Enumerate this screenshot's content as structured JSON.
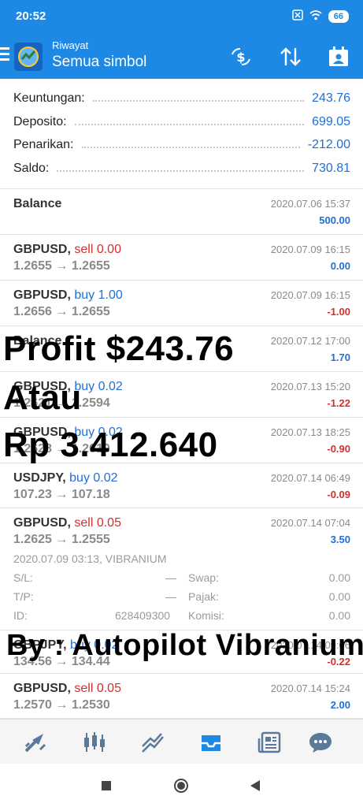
{
  "status": {
    "time": "20:52",
    "battery": "66"
  },
  "toolbar": {
    "subtitle": "Riwayat",
    "title": "Semua simbol"
  },
  "summary": {
    "profit_label": "Keuntungan:",
    "profit_value": "243.76",
    "deposit_label": "Deposito:",
    "deposit_value": "699.05",
    "withdrawal_label": "Penarikan:",
    "withdrawal_value": "-212.00",
    "balance_label": "Saldo:",
    "balance_value": "730.81"
  },
  "rows": [
    {
      "symbol": "Balance",
      "side": "",
      "volume": "",
      "prices": "",
      "time": "2020.07.06 15:37",
      "profit": "500.00"
    },
    {
      "symbol": "GBPUSD,",
      "side": "sell",
      "volume": "0.00",
      "prices": "1.2655 → 1.2655",
      "time": "2020.07.09 16:15",
      "profit": "0.00"
    },
    {
      "symbol": "GBPUSD,",
      "side": "buy",
      "volume": "1.00",
      "prices": "1.2656 → 1.2655",
      "time": "2020.07.09 16:15",
      "profit": "-1.00"
    },
    {
      "symbol": "Balance",
      "side": "",
      "volume": "",
      "prices": "",
      "time": "2020.07.12 17:00",
      "profit": "1.70"
    },
    {
      "symbol": "GBPUSD,",
      "side": "buy",
      "volume": "0.02",
      "prices": "1.2621 → 1.2594",
      "time": "2020.07.13 15:20",
      "profit": "-1.22"
    },
    {
      "symbol": "GBPUSD,",
      "side": "buy",
      "volume": "0.02",
      "prices": "1.2628 → 1.2610",
      "time": "2020.07.13 18:25",
      "profit": "-0.90"
    },
    {
      "symbol": "USDJPY,",
      "side": "buy",
      "volume": "0.02",
      "prices": "107.23 → 107.18",
      "time": "2020.07.14 06:49",
      "profit": "-0.09"
    },
    {
      "symbol": "GBPUSD,",
      "side": "sell",
      "volume": "0.05",
      "prices": "1.2625 → 1.2555",
      "time": "2020.07.14 07:04",
      "profit": "3.50"
    },
    {
      "symbol": "GBPJPY,",
      "side": "buy",
      "volume": "0.02",
      "prices": "134.56 → 134.44",
      "time": "2020.07.14 09:06",
      "profit": "-0.22"
    },
    {
      "symbol": "GBPUSD,",
      "side": "sell",
      "volume": "0.05",
      "prices": "1.2570 → 1.2530",
      "time": "2020.07.14 15:24",
      "profit": "2.00"
    }
  ],
  "details": {
    "open_info": "2020.07.09 03:13, VIBRANIUM",
    "sl_label": "S/L:",
    "sl_value": "—",
    "tp_label": "T/P:",
    "tp_value": "—",
    "id_label": "ID:",
    "id_value": "628409300",
    "swap_label": "Swap:",
    "swap_value": "0.00",
    "tax_label": "Pajak:",
    "tax_value": "0.00",
    "commission_label": "Komisi:",
    "commission_value": "0.00"
  },
  "overlay": {
    "line1": "Profit $243.76",
    "line2": "Atau",
    "line3": "Rp 3.412.640",
    "line4": "By : Autopilot Vibranium"
  },
  "nav": {
    "items": [
      "quotes-icon",
      "chart-icon",
      "trade-icon",
      "history-icon",
      "news-icon",
      "chat-icon"
    ],
    "active": "history-icon"
  },
  "colors": {
    "primary": "#1e88e5",
    "sell": "#d32f2f",
    "buy": "#1e6fd9"
  }
}
